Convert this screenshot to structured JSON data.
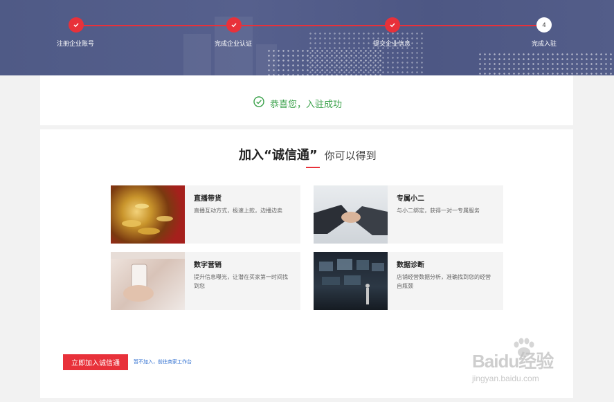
{
  "steps": [
    {
      "label": "注册企业账号",
      "state": "done"
    },
    {
      "label": "完成企业认证",
      "state": "done"
    },
    {
      "label": "提交企业信息",
      "state": "done"
    },
    {
      "label": "完成入驻",
      "state": "current",
      "number": "4"
    }
  ],
  "success": {
    "message": "恭喜您，入驻成功",
    "icon": "check-circle-icon"
  },
  "benefits": {
    "title_main": "加入“诚信通”",
    "title_sub": "你可以得到",
    "items": [
      {
        "name": "直播带货",
        "desc": "直播互动方式，极速上款，边播边卖",
        "image": "gold-coins-image"
      },
      {
        "name": "专属小二",
        "desc": "与小二绑定，获得一对一专属服务",
        "image": "handshake-image"
      },
      {
        "name": "数字营销",
        "desc": "提升信息曝光，让潜在买家第一时间找到您",
        "image": "phone-user-image"
      },
      {
        "name": "数据诊断",
        "desc": "店铺经营数据分析，准确找到您的经营自瓶颈",
        "image": "data-screen-image"
      }
    ]
  },
  "actions": {
    "join_label": "立即加入诚信通",
    "skip_label": "暂不加入，前往商家工作台"
  },
  "watermark": {
    "brand": "Baidu经验",
    "domain": "jingyan.baidu.com"
  },
  "colors": {
    "accent": "#e8313a",
    "success": "#3aa14a",
    "banner": "#535d89",
    "link": "#2f6fd0"
  }
}
